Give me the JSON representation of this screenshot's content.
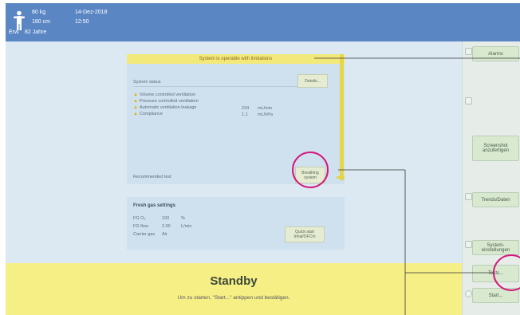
{
  "patient": {
    "weight": "80 kg",
    "height": "180 cm",
    "type": "Erw.",
    "age": "82 Jahre",
    "date": "14-Dez-2018",
    "time": "12:50"
  },
  "status_panel": {
    "banner": "System is operable with limitations",
    "title": "System status",
    "details_label": "Details...",
    "warnings": [
      {
        "label": "Volume controlled ventilation",
        "value": "",
        "unit": ""
      },
      {
        "label": "Pressure controlled ventilation",
        "value": "",
        "unit": ""
      },
      {
        "label": "Automatic ventilation leakage",
        "value": "234",
        "unit": "mL/min"
      },
      {
        "label": "Compliance",
        "value": "1.1",
        "unit": "mL/hPa"
      }
    ],
    "recommended_label": "Recommended test",
    "breathing_button": "Breathing system"
  },
  "fresh_gas": {
    "title": "Fresh gas settings",
    "rows": [
      {
        "label": "FG O₂",
        "value": "100",
        "unit": "%"
      },
      {
        "label": "FG flow",
        "value": "2.00",
        "unit": "L/min"
      },
      {
        "label": "Carrier gas",
        "value": "Air",
        "unit": ""
      }
    ],
    "quick_start_button": "Quick start Inhal/OFC/n"
  },
  "standby": {
    "title": "Standby",
    "subtitle": "Um zu starten, \"Start...\" antippen und bestätigen."
  },
  "sidebar": {
    "alarms": "Alarms",
    "screenshot": "Screenshot anzufertigen",
    "trends": "Trends/Daten",
    "system": "System-einstellungen",
    "tests": "Tests...",
    "start": "Start..."
  },
  "colors": {
    "header": "#5a86c4",
    "banner": "#f3e97a",
    "standby": "#f6ef86",
    "highlight_circle": "#d4187a"
  }
}
